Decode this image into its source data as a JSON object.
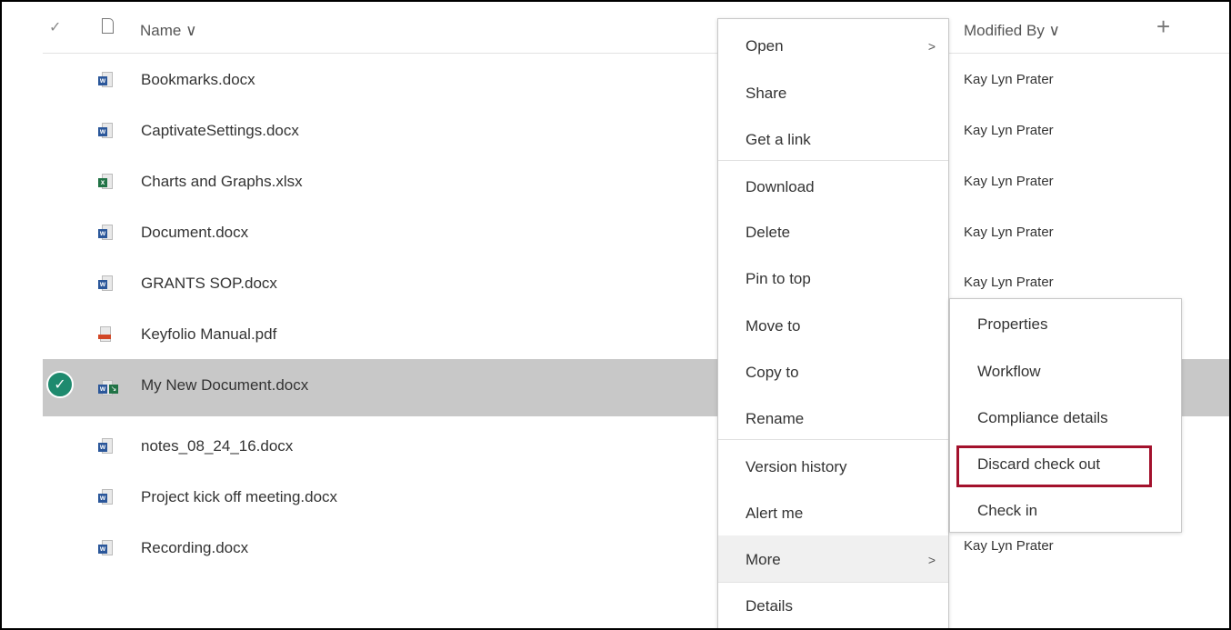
{
  "header": {
    "name_label": "Name ∨",
    "modified_by_label": "Modified By ∨",
    "add_column": "+"
  },
  "files": [
    {
      "name": "Bookmarks.docx",
      "type": "word",
      "modified_by": "Kay Lyn Prater"
    },
    {
      "name": "CaptivateSettings.docx",
      "type": "word",
      "modified_by": "Kay Lyn Prater"
    },
    {
      "name": "Charts and Graphs.xlsx",
      "type": "excel",
      "modified_by": "Kay Lyn Prater"
    },
    {
      "name": "Document.docx",
      "type": "word",
      "modified_by": "Kay Lyn Prater"
    },
    {
      "name": "GRANTS SOP.docx",
      "type": "word",
      "modified_by": "Kay Lyn Prater"
    },
    {
      "name": "Keyfolio Manual.pdf",
      "type": "pdf",
      "modified_by": ""
    },
    {
      "name": "My New Document.docx",
      "type": "word-checked-out",
      "modified_by": "",
      "selected": true
    },
    {
      "name": "notes_08_24_16.docx",
      "type": "word",
      "modified_by": ""
    },
    {
      "name": "Project kick off meeting.docx",
      "type": "word",
      "modified_by": ""
    },
    {
      "name": "Recording.docx",
      "type": "word",
      "modified_by": "Kay Lyn Prater"
    }
  ],
  "context_menu": {
    "open": "Open",
    "share": "Share",
    "get_link": "Get a link",
    "download": "Download",
    "delete": "Delete",
    "pin_to_top": "Pin to top",
    "move_to": "Move to",
    "copy_to": "Copy to",
    "rename": "Rename",
    "version_history": "Version history",
    "alert_me": "Alert me",
    "more": "More",
    "details": "Details"
  },
  "submenu": {
    "properties": "Properties",
    "workflow": "Workflow",
    "compliance_details": "Compliance details",
    "discard_check_out": "Discard check out",
    "check_in": "Check in"
  },
  "colors": {
    "highlight": "#a3112c",
    "selected_row": "#c8c8c8",
    "check_circle": "#1e8a6e",
    "word": "#2b579a",
    "excel": "#217346",
    "pdf": "#d24726"
  }
}
